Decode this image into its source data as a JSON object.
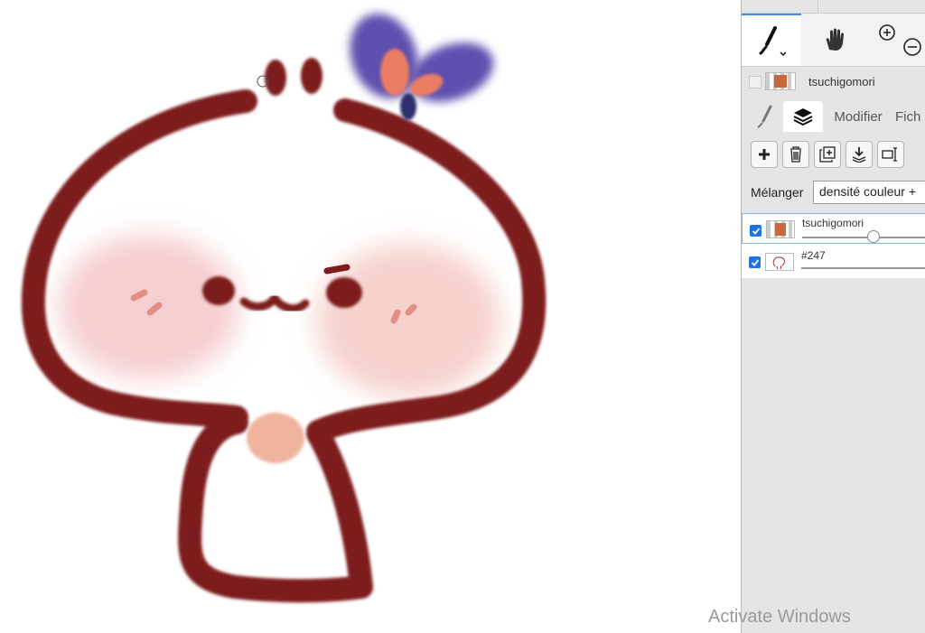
{
  "panel": {
    "tools": [
      {
        "name": "brush-tool",
        "icon": "brush-icon"
      },
      {
        "name": "pan-tool",
        "icon": "hand-icon"
      },
      {
        "name": "zoom-tool",
        "icon": "zoom-in-out-icon"
      }
    ],
    "document_name": "tsuchigomori",
    "tabs": [
      {
        "id": "brush",
        "icon": "brush-icon",
        "label": ""
      },
      {
        "id": "layers",
        "icon": "layers-icon",
        "label": ""
      },
      {
        "id": "modify",
        "label": "Modifier"
      },
      {
        "id": "file",
        "label": "Fich"
      }
    ],
    "layer_buttons": [
      "add-layer",
      "delete-layer",
      "duplicate-layer",
      "merge-down",
      "layer-properties"
    ],
    "blend_label": "Mélanger",
    "blend_value": "densité couleur +",
    "layers": [
      {
        "name": "tsuchigomori",
        "visible": true,
        "selected": true,
        "opacity": 0.57
      },
      {
        "name": "#247",
        "visible": true,
        "selected": false
      }
    ]
  },
  "watermark": "Activate Windows"
}
